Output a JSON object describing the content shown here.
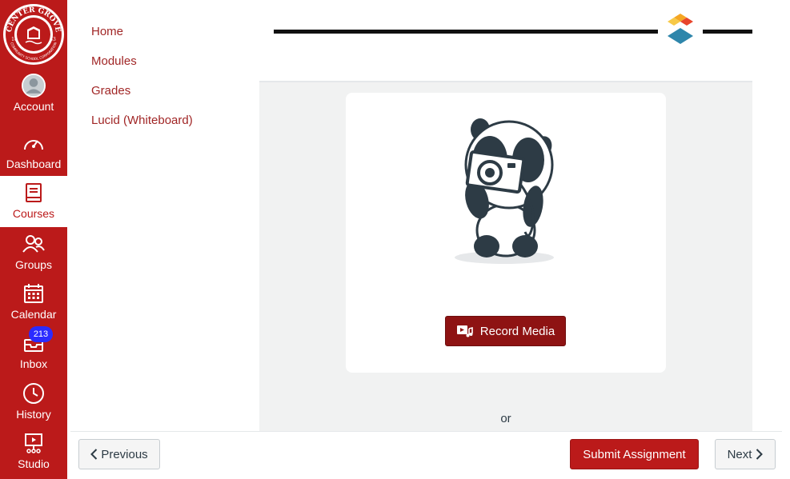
{
  "global_nav": {
    "logo_text": [
      "CENTER GROVE",
      "18",
      "83",
      "COMMUNITY SCHOOL CORPORATION"
    ],
    "items": [
      {
        "label": "Account",
        "icon": "avatar"
      },
      {
        "label": "Dashboard",
        "icon": "dashboard-icon"
      },
      {
        "label": "Courses",
        "icon": "book-icon"
      },
      {
        "label": "Groups",
        "icon": "groups-icon"
      },
      {
        "label": "Calendar",
        "icon": "calendar-icon"
      },
      {
        "label": "Inbox",
        "icon": "inbox-icon"
      },
      {
        "label": "History",
        "icon": "clock-icon"
      },
      {
        "label": "Studio",
        "icon": "studio-icon"
      }
    ],
    "inbox_count": "213",
    "accent": "#bb1a1a"
  },
  "course_nav": {
    "links": [
      "Home",
      "Modules",
      "Grades",
      "Lucid (Whiteboard)"
    ]
  },
  "tool": {
    "record_label": "Record Media",
    "or_text": "or"
  },
  "footer": {
    "previous_label": "Previous",
    "submit_label": "Submit Assignment",
    "next_label": "Next"
  }
}
